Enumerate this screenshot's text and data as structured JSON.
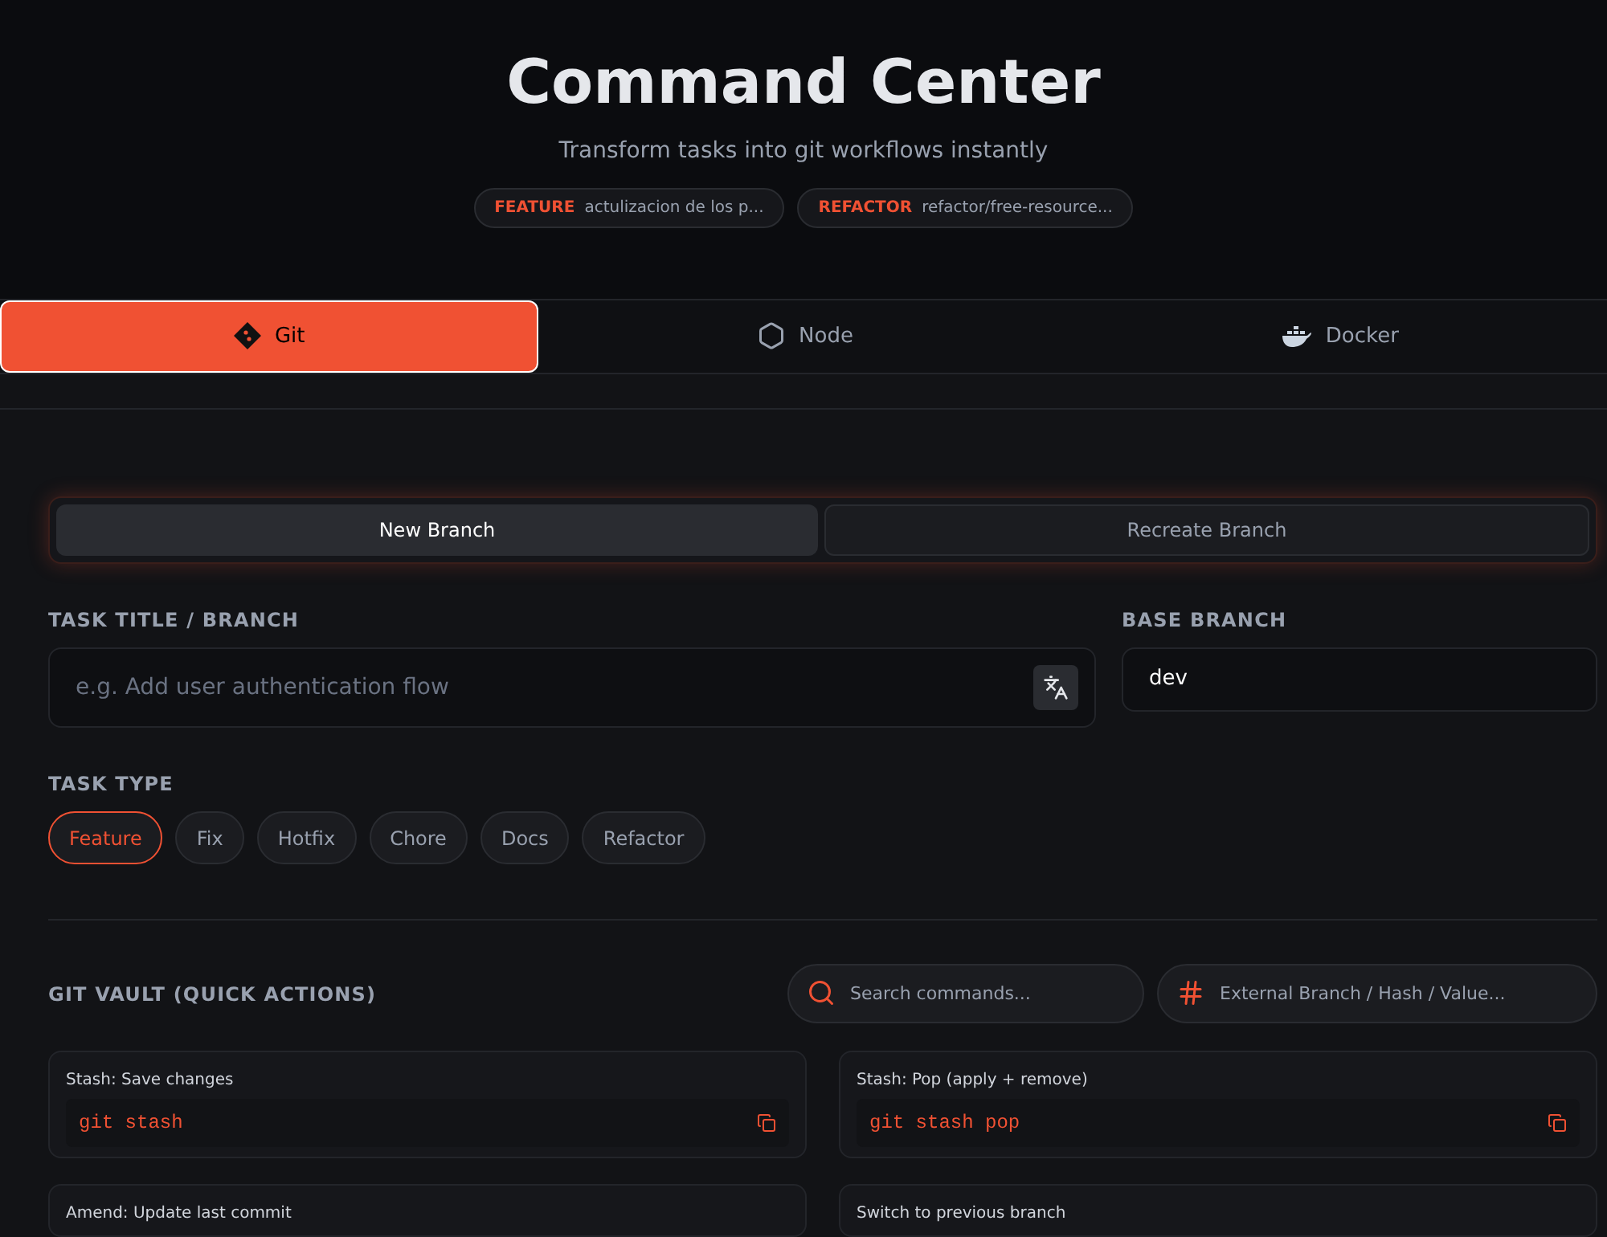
{
  "header": {
    "title": "Command Center",
    "subtitle": "Transform tasks into git workflows instantly",
    "recent": [
      {
        "type": "FEATURE",
        "name": "actulizacion de los p..."
      },
      {
        "type": "REFACTOR",
        "name": "refactor/free-resource..."
      }
    ]
  },
  "tabs": [
    {
      "label": "Git",
      "kind": "git",
      "selected": true
    },
    {
      "label": "Node",
      "kind": "node",
      "selected": false
    },
    {
      "label": "Docker",
      "kind": "docker",
      "selected": false
    }
  ],
  "modes": [
    {
      "label": "New Branch",
      "selected": true
    },
    {
      "label": "Recreate Branch",
      "selected": false
    }
  ],
  "task_title": {
    "label": "TASK TITLE / BRANCH",
    "placeholder": "e.g. Add user authentication flow"
  },
  "base_branch": {
    "label": "BASE BRANCH",
    "value": "dev"
  },
  "task_type": {
    "label": "TASK TYPE",
    "options": [
      {
        "label": "Feature",
        "selected": true
      },
      {
        "label": "Fix",
        "selected": false
      },
      {
        "label": "Hotfix",
        "selected": false
      },
      {
        "label": "Chore",
        "selected": false
      },
      {
        "label": "Docs",
        "selected": false
      },
      {
        "label": "Refactor",
        "selected": false
      }
    ]
  },
  "vault": {
    "title": "GIT VAULT (QUICK ACTIONS)",
    "search_placeholder": "Search commands...",
    "value_placeholder": "External Branch / Hash / Value...",
    "commands": [
      {
        "title": "Stash: Save changes",
        "command": "git stash"
      },
      {
        "title": "Stash: Pop (apply + remove)",
        "command": "git stash pop"
      },
      {
        "title": "Amend: Update last commit"
      },
      {
        "title": "Switch to previous branch"
      }
    ]
  }
}
